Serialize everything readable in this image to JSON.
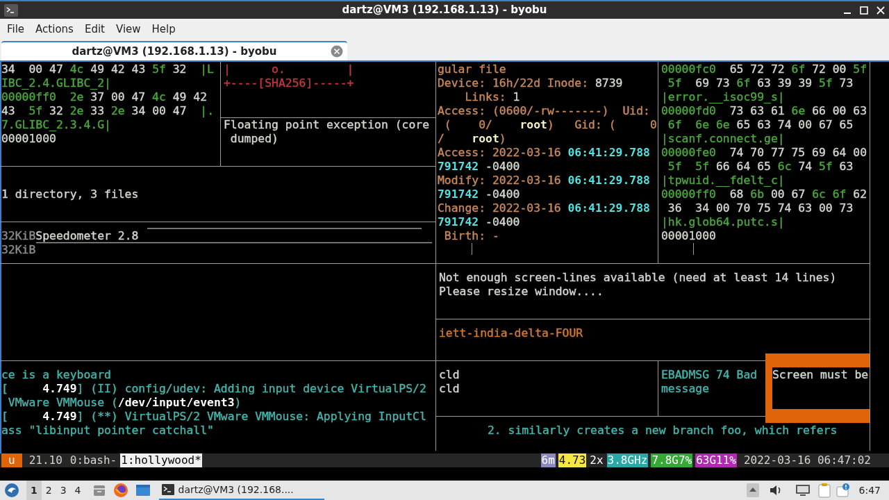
{
  "window": {
    "title": "dartz@VM3 (192.168.1.13) - byobu"
  },
  "menu": [
    "File",
    "Actions",
    "Edit",
    "View",
    "Help"
  ],
  "tabs": [
    {
      "label": "dartz@VM3 (192.168.1.13) - byobu",
      "selected": true
    }
  ],
  "terminal": {
    "panes": [
      {
        "lines": [
          [
            {
              "text": "34  00 47 ",
              "color": "#d3d7cf"
            },
            {
              "text": "4c",
              "color": "#4aa73c"
            },
            {
              "text": " 49 42 43 ",
              "color": "#d3d7cf"
            },
            {
              "text": "5f",
              "color": "#4aa73c"
            },
            {
              "text": " 32  ",
              "color": "#d3d7cf"
            },
            {
              "text": "|L",
              "color": "#4aa73c"
            }
          ],
          [
            {
              "text": "IBC_2.4.GLIBC_2|",
              "color": "#4aa73c"
            }
          ],
          [
            {
              "text": "00000ff0  2e",
              "color": "#4aa73c"
            },
            {
              "text": " 37 00 47 ",
              "color": "#d3d7cf"
            },
            {
              "text": "4c",
              "color": "#4aa73c"
            },
            {
              "text": " 49 42",
              "color": "#d3d7cf"
            }
          ],
          [
            {
              "text": "43  ",
              "color": "#d3d7cf"
            },
            {
              "text": "5f",
              "color": "#4aa73c"
            },
            {
              "text": " 32 ",
              "color": "#d3d7cf"
            },
            {
              "text": "2e",
              "color": "#4aa73c"
            },
            {
              "text": " 33 ",
              "color": "#d3d7cf"
            },
            {
              "text": "2e",
              "color": "#4aa73c"
            },
            {
              "text": " 34 00 47  ",
              "color": "#d3d7cf"
            },
            {
              "text": "|.",
              "color": "#4aa73c"
            }
          ],
          [
            {
              "text": "7.GLIBC_2.3.4.G|",
              "color": "#4aa73c"
            }
          ],
          [
            {
              "text": "00001000",
              "color": "#d3d7cf"
            }
          ]
        ]
      },
      {
        "lines": [
          [
            {
              "text": "|      o.         |",
              "color": "#c4363f"
            }
          ],
          [
            {
              "text": "+----[SHA256]-----+",
              "color": "#c4363f"
            }
          ]
        ]
      },
      {
        "lines": [
          [
            {
              "text": "Floating point exception (core",
              "color": "#d3d7cf"
            }
          ],
          [
            {
              "text": " dumped)",
              "color": "#d3d7cf"
            }
          ]
        ]
      },
      {
        "lines": [
          [
            {
              "text": "gular file",
              "color": "#c8895a"
            }
          ],
          [
            {
              "text": "Device: 16h/22d Inode: ",
              "color": "#c8895a"
            },
            {
              "text": "8739",
              "color": "#d3d7cf"
            }
          ],
          [
            {
              "text": "    Links: ",
              "color": "#c8895a"
            },
            {
              "text": "1",
              "color": "#d3d7cf"
            }
          ],
          [
            {
              "text": "Access: (0600/-rw-------)  Uid:",
              "color": "#c8895a"
            }
          ],
          [
            {
              "text": " (    0/    ",
              "color": "#c8895a"
            },
            {
              "text": "root",
              "color": "#f4f4c8",
              "bold": true
            },
            {
              "text": ")   Gid: (     0",
              "color": "#c8895a"
            }
          ],
          [
            {
              "text": "/    ",
              "color": "#c8895a"
            },
            {
              "text": "root",
              "color": "#f4f4c8",
              "bold": true
            },
            {
              "text": ")",
              "color": "#c8895a"
            }
          ],
          [
            {
              "text": "Access: 2022-03-16 ",
              "color": "#c8895a"
            },
            {
              "text": "06:41:29.788",
              "color": "#4fe0e0",
              "bold": true
            }
          ],
          [
            {
              "text": "791742",
              "color": "#4fe0e0",
              "bold": true
            },
            {
              "text": " -0400",
              "color": "#d3d7cf"
            }
          ],
          [
            {
              "text": "Modify: 2022-03-16 ",
              "color": "#c8895a"
            },
            {
              "text": "06:41:29.788",
              "color": "#4fe0e0",
              "bold": true
            }
          ],
          [
            {
              "text": "791742",
              "color": "#4fe0e0",
              "bold": true
            },
            {
              "text": " -0400",
              "color": "#d3d7cf"
            }
          ],
          [
            {
              "text": "Change: 2022-03-16 ",
              "color": "#c8895a"
            },
            {
              "text": "06:41:29.788",
              "color": "#4fe0e0",
              "bold": true
            }
          ],
          [
            {
              "text": "791742",
              "color": "#4fe0e0",
              "bold": true
            },
            {
              "text": " -0400",
              "color": "#d3d7cf"
            }
          ],
          [
            {
              "text": " Birth: -",
              "color": "#c8895a"
            }
          ]
        ]
      },
      {
        "lines": [
          [
            {
              "text": "00000fc0",
              "color": "#4aa73c"
            },
            {
              "text": "  65 72 72 ",
              "color": "#d3d7cf"
            },
            {
              "text": "6f",
              "color": "#4aa73c"
            },
            {
              "text": " 72 00 ",
              "color": "#d3d7cf"
            },
            {
              "text": "5f",
              "color": "#4aa73c"
            }
          ],
          [
            {
              "text": " 5f",
              "color": "#4aa73c"
            },
            {
              "text": "  69 73 ",
              "color": "#d3d7cf"
            },
            {
              "text": "6f",
              "color": "#4aa73c"
            },
            {
              "text": " 63 39 39 ",
              "color": "#d3d7cf"
            },
            {
              "text": "5f",
              "color": "#4aa73c"
            },
            {
              "text": " 73",
              "color": "#d3d7cf"
            }
          ],
          [
            {
              "text": "|error.__isoc99_s|",
              "color": "#4aa73c"
            }
          ],
          [
            {
              "text": "00000fd0",
              "color": "#4aa73c"
            },
            {
              "text": "  73 63 61 ",
              "color": "#d3d7cf"
            },
            {
              "text": "6e",
              "color": "#4aa73c"
            },
            {
              "text": " 66 00 63",
              "color": "#d3d7cf"
            }
          ],
          [
            {
              "text": " 6f  6e 6e",
              "color": "#4aa73c"
            },
            {
              "text": " 65 63 74 00 67 65",
              "color": "#d3d7cf"
            }
          ],
          [
            {
              "text": "|scanf.connect.ge|",
              "color": "#4aa73c"
            }
          ],
          [
            {
              "text": "00000fe0",
              "color": "#4aa73c"
            },
            {
              "text": "  74 70 77 75 69 64 00",
              "color": "#d3d7cf"
            }
          ],
          [
            {
              "text": " 5f  5f",
              "color": "#4aa73c"
            },
            {
              "text": " 66 64 65 ",
              "color": "#d3d7cf"
            },
            {
              "text": "6c",
              "color": "#4aa73c"
            },
            {
              "text": " 74 ",
              "color": "#d3d7cf"
            },
            {
              "text": "5f",
              "color": "#4aa73c"
            },
            {
              "text": " 63",
              "color": "#d3d7cf"
            }
          ],
          [
            {
              "text": "|tpwuid.__fdelt_c|",
              "color": "#4aa73c"
            }
          ],
          [
            {
              "text": "00000ff0",
              "color": "#4aa73c"
            },
            {
              "text": "  68 ",
              "color": "#d3d7cf"
            },
            {
              "text": "6b",
              "color": "#4aa73c"
            },
            {
              "text": " 00 67 ",
              "color": "#d3d7cf"
            },
            {
              "text": "6c 6f",
              "color": "#4aa73c"
            },
            {
              "text": " 62",
              "color": "#d3d7cf"
            }
          ],
          [
            {
              "text": " 36  34 00 70 75 74 63 00 73",
              "color": "#d3d7cf"
            }
          ],
          [
            {
              "text": "|hk.glob64.putc.s|",
              "color": "#4aa73c"
            }
          ],
          [
            {
              "text": "00001000",
              "color": "#d3d7cf"
            }
          ]
        ]
      },
      {
        "lines": [
          [
            {
              "text": "1 directory, 3 files",
              "color": "#d3d7cf"
            }
          ]
        ]
      },
      {
        "lines": [
          [
            {
              "text": "32KiB",
              "color": "#8c8c8c"
            },
            {
              "text": "Speedometer 2.8",
              "color": "#d3d7cf"
            }
          ],
          [
            {
              "text": "32KiB",
              "color": "#8c8c8c"
            }
          ]
        ]
      },
      {
        "lines": [
          [
            {
              "text": "Not enough screen-lines available (need at least 14 lines)",
              "color": "#d3d7cf"
            }
          ],
          [
            {
              "text": "Please resize window....",
              "color": "#d3d7cf"
            }
          ]
        ]
      },
      {
        "lines": [
          [
            {
              "text": "iett-india-delta-FOUR",
              "color": "#d2792e"
            }
          ]
        ]
      },
      {
        "lines": [
          [
            {
              "text": "ce is a keyboard",
              "color": "#43b6ad"
            }
          ],
          [
            {
              "text": "[     ",
              "color": "#43b6ad"
            },
            {
              "text": "4.749",
              "color": "#ffffff",
              "bold": true
            },
            {
              "text": "] (II) config/udev: Adding input device VirtualPS/2",
              "color": "#43b6ad"
            }
          ],
          [
            {
              "text": " VMware VMMouse (",
              "color": "#43b6ad"
            },
            {
              "text": "/dev/input/event3",
              "color": "#ffffff",
              "bold": true
            },
            {
              "text": ")",
              "color": "#43b6ad"
            }
          ],
          [
            {
              "text": "[     ",
              "color": "#43b6ad"
            },
            {
              "text": "4.749",
              "color": "#ffffff",
              "bold": true
            },
            {
              "text": "] (**) VirtualPS/2 VMware VMMouse: Applying InputCl",
              "color": "#43b6ad"
            }
          ],
          [
            {
              "text": "ass \"libinput pointer catchall\"",
              "color": "#43b6ad"
            }
          ]
        ]
      },
      {
        "lines": [
          [
            {
              "text": "cld",
              "color": "#d3d7cf"
            }
          ],
          [
            {
              "text": "cld",
              "color": "#d3d7cf"
            }
          ]
        ]
      },
      {
        "lines": [
          [
            {
              "text": "EBADMSG 74 Bad",
              "color": "#43b6ad"
            }
          ],
          [
            {
              "text": "message",
              "color": "#43b6ad"
            }
          ]
        ]
      },
      {
        "lines": [
          [
            {
              "text": "Screen must be",
              "color": "#d3d7cf"
            }
          ]
        ]
      },
      {
        "lines": [
          [
            {
              "text": "2. similarly creates a new branch foo, which refers",
              "color": "#43b6ad"
            }
          ]
        ]
      }
    ]
  },
  "status_bar": {
    "logo": "u",
    "release": "21.10",
    "windows": [
      {
        "label": "0:bash-",
        "selected": false
      },
      {
        "label": "1:hollywood*",
        "selected": true
      }
    ],
    "indicators": [
      {
        "text": "6m",
        "color": "#8a8ac0"
      },
      {
        "text": "4.73",
        "color": "#f5e642"
      },
      {
        "text": "2x",
        "color": "#262626"
      },
      {
        "text": "3.8GHz",
        "color": "#2aa8a8"
      },
      {
        "text": "7.8G7%",
        "color": "#36a836"
      },
      {
        "text": "63G11%",
        "color": "#b02ab0"
      }
    ],
    "datetime": "2022-03-16 06:47:02"
  },
  "taskbar": {
    "workspaces": [
      {
        "label": "1",
        "selected": true
      },
      {
        "label": "2",
        "selected": false
      },
      {
        "label": "3",
        "selected": false
      },
      {
        "label": "4",
        "selected": false
      }
    ],
    "tasks": [
      {
        "label": "dartz@VM3 (192.168....",
        "active": true
      }
    ],
    "clock": "6:47"
  }
}
